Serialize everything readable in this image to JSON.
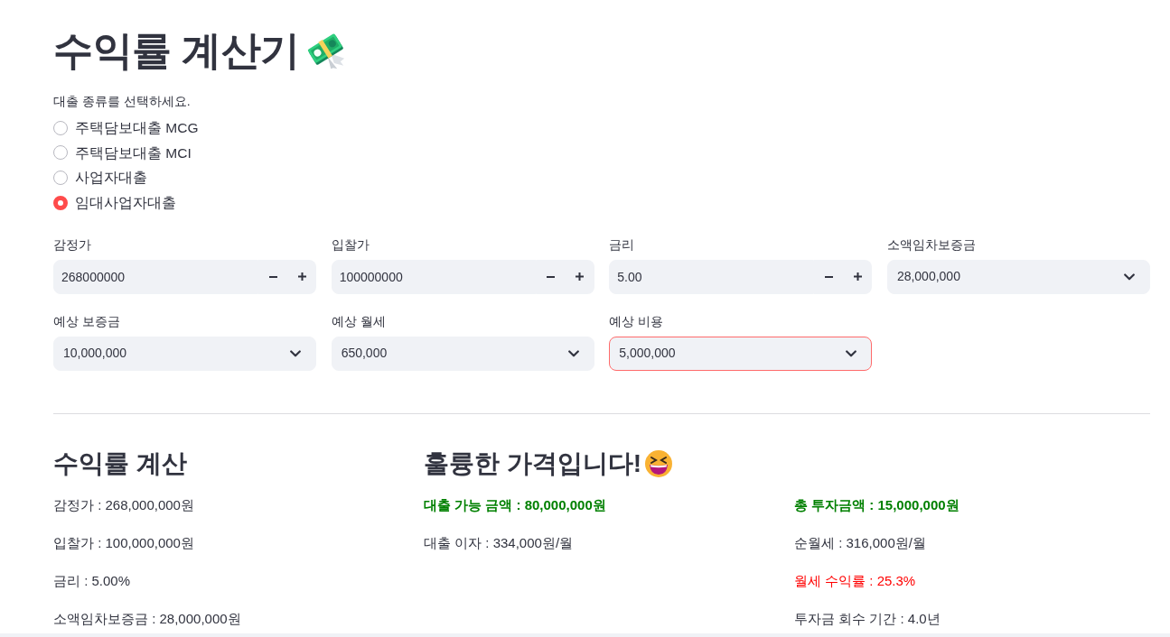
{
  "title": "수익률 계산기",
  "loan_type": {
    "label": "대출 종류를 선택하세요.",
    "options": [
      {
        "label": "주택담보대출 MCG",
        "selected": false
      },
      {
        "label": "주택담보대출 MCI",
        "selected": false
      },
      {
        "label": "사업자대출",
        "selected": false
      },
      {
        "label": "임대사업자대출",
        "selected": true
      }
    ]
  },
  "inputs": [
    {
      "kind": "number",
      "label": "감정가",
      "value": "268000000",
      "focused": false
    },
    {
      "kind": "number",
      "label": "입찰가",
      "value": "100000000",
      "focused": false
    },
    {
      "kind": "number",
      "label": "금리",
      "value": "5.00",
      "focused": false
    },
    {
      "kind": "select",
      "label": "소액임차보증금",
      "value": "28,000,000",
      "focused": false
    },
    {
      "kind": "select",
      "label": "예상 보증금",
      "value": "10,000,000",
      "focused": false
    },
    {
      "kind": "select",
      "label": "예상 월세",
      "value": "650,000",
      "focused": false
    },
    {
      "kind": "select",
      "label": "예상 비용",
      "value": "5,000,000",
      "focused": true
    }
  ],
  "results": [
    {
      "heading": "수익률 계산",
      "lines": [
        {
          "text": "감정가 : 268,000,000원",
          "bold": false
        },
        {
          "text": "입찰가 : 100,000,000원",
          "bold": false
        },
        {
          "text": "금리 : 5.00%",
          "bold": false
        },
        {
          "text": "소액임차보증금 : 28,000,000원",
          "bold": false
        }
      ]
    },
    {
      "heading": "훌륭한 가격입니다!",
      "lines": [
        {
          "text": "대출 가능 금액 : 80,000,000원",
          "bold": true,
          "color": "#008000"
        },
        {
          "text": "대출 이자 : 334,000원/월",
          "bold": false
        }
      ]
    },
    {
      "lines": [
        {
          "text": "총 투자금액 : 15,000,000원",
          "bold": true,
          "color": "#008000"
        },
        {
          "text": "순월세 : 316,000원/월",
          "bold": false
        },
        {
          "text": "월세 수익률 : 25.3%",
          "bold": false,
          "color": "#ff0000"
        },
        {
          "text": "투자금 회수 기간 : 4.0년",
          "bold": false
        }
      ]
    }
  ]
}
